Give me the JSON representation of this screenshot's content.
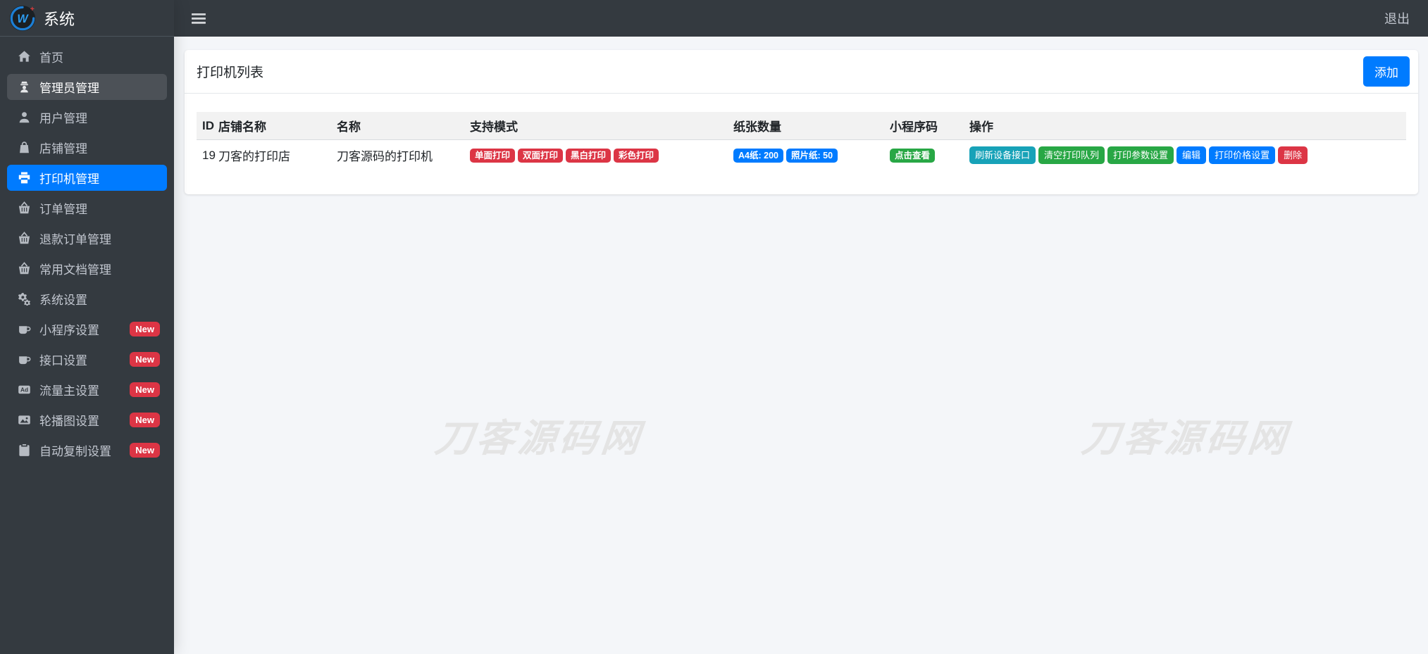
{
  "brand": {
    "title": "系统"
  },
  "topbar": {
    "logout_label": "退出"
  },
  "sidebar": {
    "items": [
      {
        "label": "首页",
        "icon": "home"
      },
      {
        "label": "管理员管理",
        "icon": "user-secret",
        "highlighted": true
      },
      {
        "label": "用户管理",
        "icon": "user"
      },
      {
        "label": "店铺管理",
        "icon": "shopping-bag"
      },
      {
        "label": "打印机管理",
        "icon": "printer",
        "active": true
      },
      {
        "label": "订单管理",
        "icon": "basket"
      },
      {
        "label": "退款订单管理",
        "icon": "basket"
      },
      {
        "label": "常用文档管理",
        "icon": "basket"
      },
      {
        "label": "系统设置",
        "icon": "cogs"
      },
      {
        "label": "小程序设置",
        "icon": "mug",
        "badge": "New"
      },
      {
        "label": "接口设置",
        "icon": "mug",
        "badge": "New"
      },
      {
        "label": "流量主设置",
        "icon": "ad",
        "badge": "New"
      },
      {
        "label": "轮播图设置",
        "icon": "image",
        "badge": "New"
      },
      {
        "label": "自动复制设置",
        "icon": "clipboard",
        "badge": "New"
      }
    ]
  },
  "page": {
    "title": "打印机列表",
    "add_button_label": "添加"
  },
  "table": {
    "headers": [
      "ID",
      "店铺名称",
      "名称",
      "支持模式",
      "纸张数量",
      "小程序码",
      "操作"
    ],
    "rows": [
      {
        "id": "19",
        "shop_name": "刀客的打印店",
        "printer_name": "刀客源码的打印机",
        "modes": [
          {
            "label": "单面打印",
            "variant": "danger"
          },
          {
            "label": "双面打印",
            "variant": "danger"
          },
          {
            "label": "黑白打印",
            "variant": "danger"
          },
          {
            "label": "彩色打印",
            "variant": "danger"
          }
        ],
        "papers": [
          {
            "label": "A4纸: 200",
            "variant": "primary"
          },
          {
            "label": "照片纸: 50",
            "variant": "primary"
          }
        ],
        "qrcode": {
          "label": "点击查看",
          "variant": "success"
        },
        "actions": [
          {
            "label": "刷新设备接口",
            "variant": "info"
          },
          {
            "label": "清空打印队列",
            "variant": "success"
          },
          {
            "label": "打印参数设置",
            "variant": "success"
          },
          {
            "label": "编辑",
            "variant": "primary"
          },
          {
            "label": "打印价格设置",
            "variant": "primary"
          },
          {
            "label": "删除",
            "variant": "danger"
          }
        ]
      }
    ]
  },
  "watermark": {
    "text": "刀客源码网"
  },
  "colors": {
    "primary": "#007bff",
    "danger": "#dc3545",
    "success": "#28a745",
    "info": "#17a2b8",
    "sidebar_bg": "#343a40",
    "content_bg": "#f4f6f9"
  }
}
